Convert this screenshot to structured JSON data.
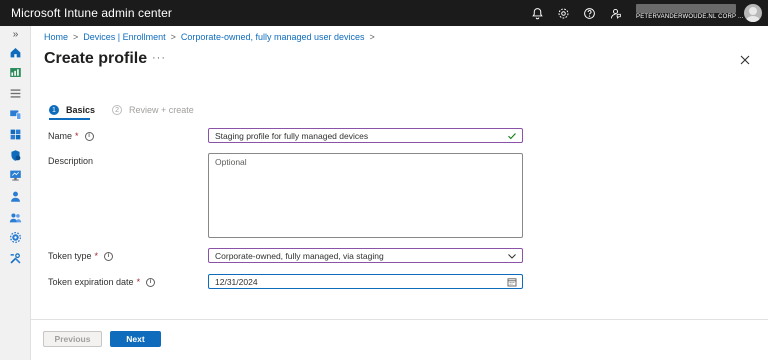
{
  "app": {
    "title": "Microsoft Intune admin center"
  },
  "topbar": {
    "icons": [
      "bell-icon",
      "gear-icon",
      "help-icon",
      "feedback-icon"
    ],
    "tenant_name": "PETERVANDERWOUDE.NL CORP ..."
  },
  "leftnav": {
    "expand_label": "»",
    "items": [
      "home-icon",
      "dashboard-icon",
      "all-services-icon",
      "devices-icon",
      "apps-icon",
      "endpoint-security-icon",
      "reports-icon",
      "users-icon",
      "groups-icon",
      "tenant-administration-icon",
      "troubleshooting-icon"
    ]
  },
  "breadcrumb": {
    "items": [
      "Home",
      "Devices | Enrollment",
      "Corporate-owned, fully managed user devices"
    ],
    "separator": ">"
  },
  "page": {
    "title": "Create profile",
    "more_label": "···"
  },
  "steps": [
    {
      "number": "1",
      "label": "Basics",
      "active": true
    },
    {
      "number": "2",
      "label": "Review + create",
      "active": false
    }
  ],
  "form": {
    "name": {
      "label": "Name",
      "required_marker": "*",
      "value": "Staging profile for fully managed devices"
    },
    "description": {
      "label": "Description",
      "placeholder": "Optional"
    },
    "token_type": {
      "label": "Token type",
      "required_marker": "*",
      "value": "Corporate-owned, fully managed, via staging"
    },
    "token_expiration": {
      "label": "Token expiration date",
      "required_marker": "*",
      "value": "12/31/2024"
    },
    "info_glyph": "i"
  },
  "buttons": {
    "previous": "Previous",
    "next": "Next"
  },
  "colors": {
    "accent": "#0f6cbd",
    "topbar": "#1b1b1b",
    "valid_border": "#8a53a8",
    "required": "#a4262c",
    "check": "#107c10"
  }
}
